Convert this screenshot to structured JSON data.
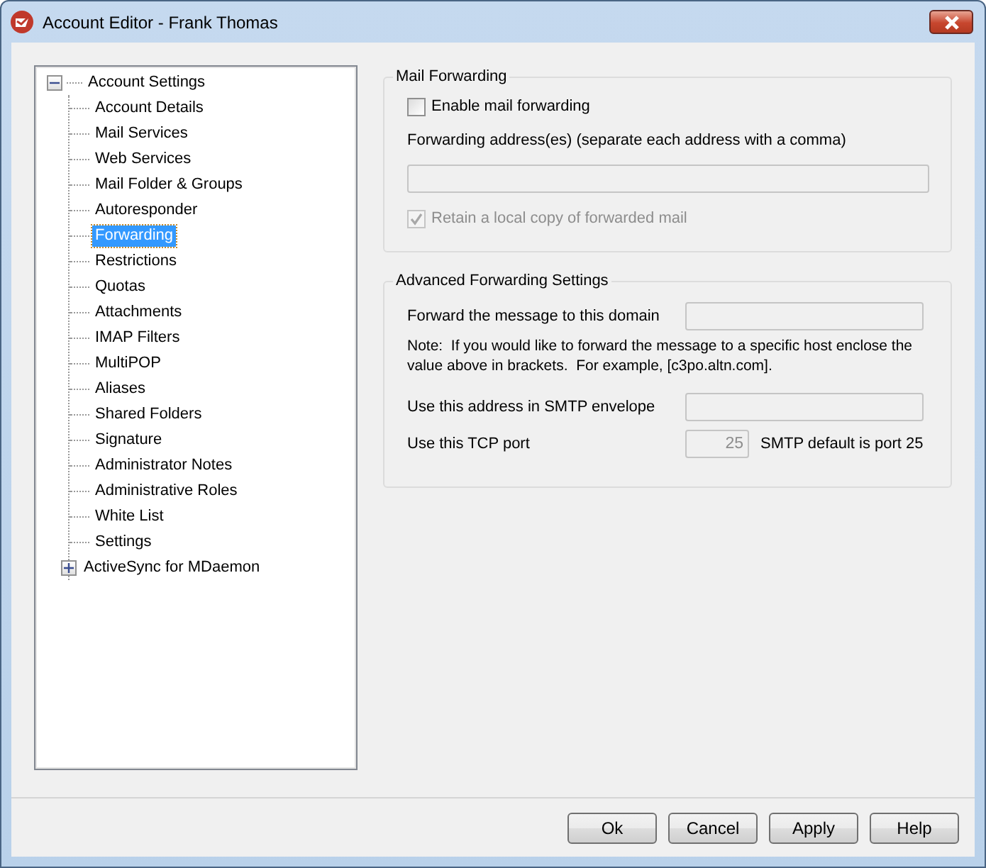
{
  "window": {
    "title": "Account Editor - Frank Thomas"
  },
  "tree": {
    "label": "Account Settings",
    "expanded": true,
    "selected": false,
    "children": [
      {
        "label": "Account Details",
        "selected": false
      },
      {
        "label": "Mail Services",
        "selected": false
      },
      {
        "label": "Web Services",
        "selected": false
      },
      {
        "label": "Mail Folder & Groups",
        "selected": false
      },
      {
        "label": "Autoresponder",
        "selected": false
      },
      {
        "label": "Forwarding",
        "selected": true
      },
      {
        "label": "Restrictions",
        "selected": false
      },
      {
        "label": "Quotas",
        "selected": false
      },
      {
        "label": "Attachments",
        "selected": false
      },
      {
        "label": "IMAP Filters",
        "selected": false
      },
      {
        "label": "MultiPOP",
        "selected": false
      },
      {
        "label": "Aliases",
        "selected": false
      },
      {
        "label": "Shared Folders",
        "selected": false
      },
      {
        "label": "Signature",
        "selected": false
      },
      {
        "label": "Administrator Notes",
        "selected": false
      },
      {
        "label": "Administrative Roles",
        "selected": false
      },
      {
        "label": "White List",
        "selected": false
      },
      {
        "label": "Settings",
        "selected": false
      },
      {
        "label": "ActiveSync for MDaemon",
        "selected": false,
        "expanded": false
      }
    ]
  },
  "mail_forwarding": {
    "title": "Mail Forwarding",
    "enable": {
      "label": "Enable mail forwarding",
      "checked": false,
      "disabled": false
    },
    "address_label": "Forwarding address(es) (separate each address with a comma)",
    "address_field": {
      "disabled": true
    },
    "retain": {
      "label": "Retain a local copy of forwarded mail",
      "checked": true,
      "disabled": true
    }
  },
  "advanced": {
    "title": "Advanced Forwarding Settings",
    "domain": {
      "label": "Forward the message to this domain",
      "disabled": true
    },
    "note": "Note:  If you would like to forward the message to a specific host enclose the value above in brackets.  For example, [c3po.altn.com].",
    "envelope": {
      "label": "Use this address in SMTP envelope",
      "disabled": true
    },
    "port": {
      "label": "Use this TCP port",
      "value": "25",
      "disabled": true,
      "hint": "SMTP default is port 25"
    }
  },
  "buttons": [
    "Ok",
    "Cancel",
    "Apply",
    "Help"
  ]
}
